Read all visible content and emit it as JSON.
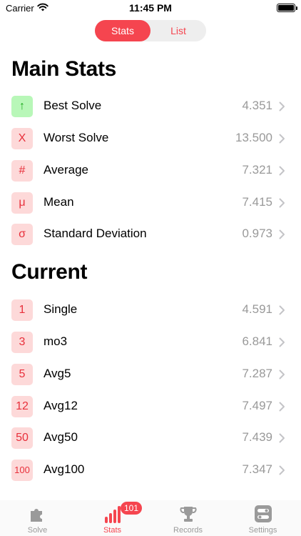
{
  "status_bar": {
    "carrier": "Carrier",
    "time": "11:45 PM"
  },
  "segmented": {
    "stats_label": "Stats",
    "list_label": "List"
  },
  "main_stats": {
    "title": "Main Stats",
    "rows": [
      {
        "badge": "↑",
        "label": "Best Solve",
        "value": "4.351"
      },
      {
        "badge": "X",
        "label": "Worst Solve",
        "value": "13.500"
      },
      {
        "badge": "#",
        "label": "Average",
        "value": "7.321"
      },
      {
        "badge": "μ",
        "label": "Mean",
        "value": "7.415"
      },
      {
        "badge": "σ",
        "label": "Standard Deviation",
        "value": "0.973"
      }
    ]
  },
  "current": {
    "title": "Current",
    "rows": [
      {
        "badge": "1",
        "label": "Single",
        "value": "4.591"
      },
      {
        "badge": "3",
        "label": "mo3",
        "value": "6.841"
      },
      {
        "badge": "5",
        "label": "Avg5",
        "value": "7.287"
      },
      {
        "badge": "12",
        "label": "Avg12",
        "value": "7.497"
      },
      {
        "badge": "50",
        "label": "Avg50",
        "value": "7.439"
      },
      {
        "badge": "100",
        "label": "Avg100",
        "value": "7.347"
      }
    ]
  },
  "tab_bar": {
    "tabs": [
      {
        "label": "Solve",
        "icon": "puzzle-icon"
      },
      {
        "label": "Stats",
        "icon": "bar-chart-icon",
        "badge": "101"
      },
      {
        "label": "Records",
        "icon": "trophy-icon"
      },
      {
        "label": "Settings",
        "icon": "toggles-icon"
      }
    ],
    "active": "Stats"
  },
  "colors": {
    "accent": "#f5454f",
    "badge_bg": "#fdd9d9",
    "badge_green_bg": "#b8f7b8",
    "value_gray": "#999999"
  }
}
